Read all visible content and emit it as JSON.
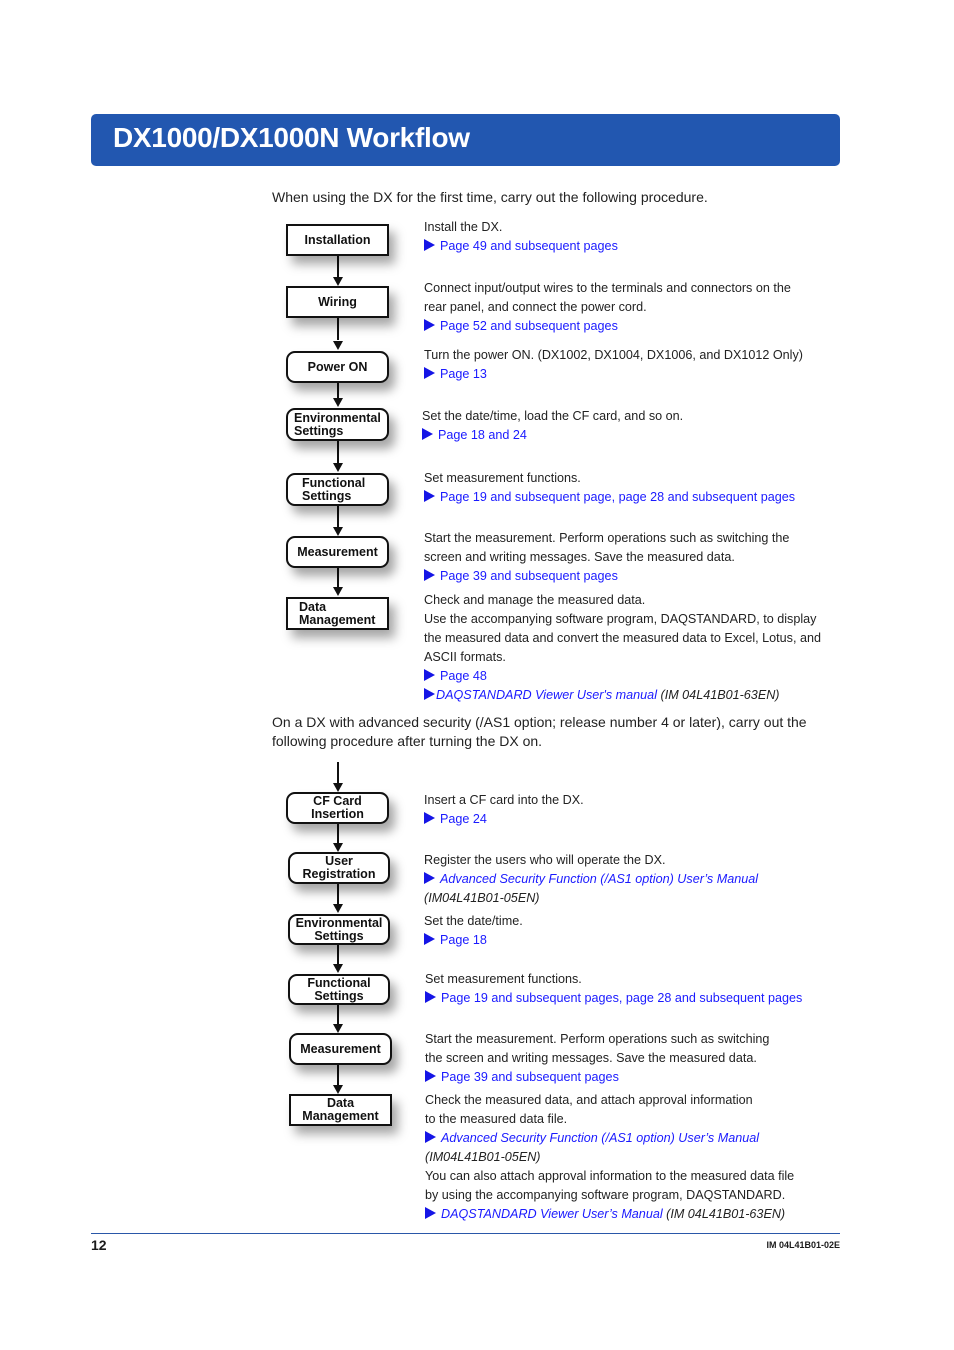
{
  "title": "DX1000/DX1000N Workflow",
  "intro1": "When using the DX for the first time, carry out the following procedure.",
  "flow1": {
    "steps": [
      {
        "label": "Installation"
      },
      {
        "label": "Wiring"
      },
      {
        "label": "Power ON"
      },
      {
        "label": "Environmental\nSettings"
      },
      {
        "label": "Functional\nSettings"
      },
      {
        "label": "Measurement"
      },
      {
        "label": "Data\nManagement"
      }
    ],
    "descriptions": [
      {
        "lines": [
          "Install the DX."
        ],
        "links": [
          "Page 49 and subsequent pages"
        ]
      },
      {
        "lines": [
          "Connect input/output wires to the terminals and connectors on the",
          "rear panel, and connect the power cord."
        ],
        "links": [
          "Page 52 and subsequent pages"
        ]
      },
      {
        "lines": [
          "Turn the power ON.  (DX1002, DX1004, DX1006, and DX1012 Only)"
        ],
        "links": [
          "Page 13"
        ]
      },
      {
        "lines": [
          "Set the date/time, load the CF card, and so on."
        ],
        "links": [
          "Page 18 and 24"
        ]
      },
      {
        "lines": [
          "Set measurement functions."
        ],
        "links": [
          "Page 19 and subsequent page, page 28 and subsequent pages"
        ]
      },
      {
        "lines": [
          "Start the measurement.  Perform operations such as switching the",
          "screen and writing messages.  Save the measured data."
        ],
        "links": [
          "Page 39 and subsequent pages"
        ]
      },
      {
        "lines": [
          "Check and manage the measured data.",
          "Use the accompanying software program, DAQSTANDARD, to  display",
          "the measured data and convert the measured data to Excel, Lotus, and",
          "ASCII formats."
        ],
        "links": [
          "Page 48"
        ],
        "manual_link": "DAQSTANDARD Viewer User's manual",
        "manual_ref": "(IM 04L41B01-63EN)"
      }
    ]
  },
  "intro2_line1": "On a DX with advanced security (/AS1 option; release number 4 or later), carry out the",
  "intro2_line2": "following procedure after turning the DX on.",
  "flow2": {
    "steps": [
      {
        "label": "CF Card\nInsertion"
      },
      {
        "label": "User\nRegistration"
      },
      {
        "label": "Environmental\nSettings"
      },
      {
        "label": "Functional\nSettings"
      },
      {
        "label": "Measurement"
      },
      {
        "label": "Data\nManagement"
      }
    ],
    "descriptions": [
      {
        "lines": [
          "Insert a CF card into the DX."
        ],
        "links": [
          "Page 24"
        ]
      },
      {
        "lines": [
          "Register the users who will operate the DX."
        ],
        "manual_link": "Advanced Security Function (/AS1 option) User’s Manual",
        "manual_ref": "(IM04L41B01-05EN)"
      },
      {
        "lines": [
          "Set the date/time."
        ],
        "links": [
          "Page 18"
        ]
      },
      {
        "lines": [
          "Set measurement functions."
        ],
        "links": [
          "Page 19 and subsequent pages, page 28 and subsequent pages"
        ]
      },
      {
        "lines": [
          "Start the measurement. Perform operations such as switching",
          "the screen and writing messages. Save the measured data."
        ],
        "links": [
          "Page 39 and subsequent pages"
        ]
      },
      {
        "lines": [
          "Check the measured data, and attach approval information",
          "to the measured data file."
        ],
        "manual_link": "Advanced Security Function (/AS1 option) User’s Manual",
        "manual_ref": "(IM04L41B01-05EN)",
        "extra_lines": [
          "You can also attach approval information to the measured data file",
          "by using the accompanying software program, DAQSTANDARD."
        ],
        "manual_link2": "DAQSTANDARD Viewer User’s Manual",
        "manual_ref2": "(IM 04L41B01-63EN)"
      }
    ]
  },
  "footer": {
    "page_number": "12",
    "doc_id": "IM 04L41B01-02E"
  },
  "colors": {
    "banner": "#2257b0",
    "link": "#1a1aff",
    "rule": "#2a57a8"
  }
}
